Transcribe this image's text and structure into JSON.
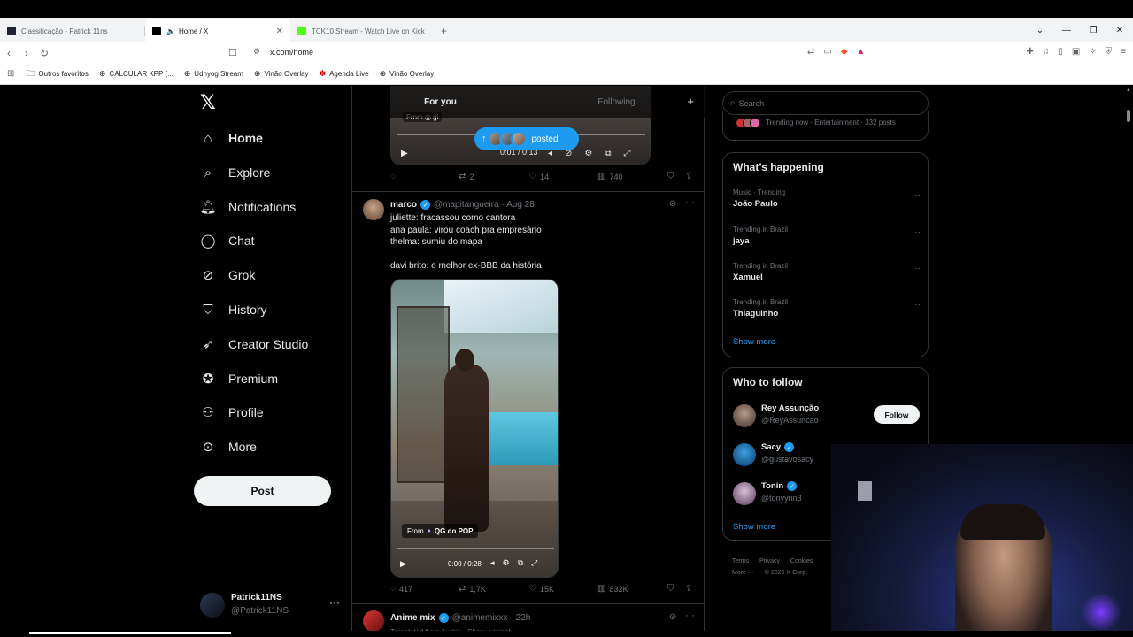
{
  "browser": {
    "tabs": [
      {
        "title": "Classificação - Patrick 11ns",
        "active": false
      },
      {
        "title": "Home / X",
        "active": true
      },
      {
        "title": "TCK10 Stream - Watch Live on Kick",
        "active": false
      }
    ],
    "new_tab": "+",
    "url": "x.com/home",
    "bookmarks": [
      {
        "label": "Outros favoritos",
        "icon": "folder-icon"
      },
      {
        "label": "CALCULAR KPP (...",
        "icon": "globe-icon"
      },
      {
        "label": "Udhyog Stream",
        "icon": "globe-icon"
      },
      {
        "label": "Vinão Overlay",
        "icon": "globe-icon"
      },
      {
        "label": "Agenda Live",
        "icon": "globe-icon"
      },
      {
        "label": "Vinão Overlay",
        "icon": "globe-icon"
      }
    ]
  },
  "nav": {
    "logo": "𝕏",
    "items": [
      {
        "label": "Home",
        "icon": "home-icon"
      },
      {
        "label": "Explore",
        "icon": "search-icon"
      },
      {
        "label": "Notifications",
        "icon": "bell-icon"
      },
      {
        "label": "Chat",
        "icon": "chat-icon"
      },
      {
        "label": "Grok",
        "icon": "grok-icon"
      },
      {
        "label": "History",
        "icon": "bookmark-icon"
      },
      {
        "label": "Creator Studio",
        "icon": "rocket-icon"
      },
      {
        "label": "Premium",
        "icon": "verified-icon"
      },
      {
        "label": "Profile",
        "icon": "person-icon"
      },
      {
        "label": "More",
        "icon": "more-circle-icon"
      }
    ],
    "post_label": "Post",
    "account": {
      "name": "Patrick11NS",
      "handle": "@Patrick11NS"
    }
  },
  "feed": {
    "tabs": [
      "For you",
      "Following"
    ],
    "posted_pill": "posted",
    "video1": {
      "time": "0:01 / 0:13"
    },
    "tweet1_actions": {
      "replies": "",
      "reposts": "2",
      "likes": "14",
      "views": "740"
    },
    "tweet2": {
      "name": "marco",
      "handle": "@mapitangueira",
      "date": "· Aug 28",
      "lines": [
        "juliette: fracassou como cantora",
        "ana paula: virou coach pra empresário",
        "thelma: sumiu do mapa",
        "",
        "davi brito: o melhor ex-BBB da história"
      ],
      "video": {
        "from_prefix": "From",
        "from_name": "QG do POP",
        "time": "0:00 / 0:28"
      },
      "actions": {
        "replies": "417",
        "reposts": "1,7K",
        "likes": "15K",
        "views": "832K"
      }
    },
    "tweet3": {
      "name": "Anime mix",
      "handle": "@animemixxx",
      "date": "· 22h",
      "sub": "Translated from Arabic · Show original"
    }
  },
  "sidebar": {
    "search_placeholder": "Search",
    "top_trend": "Trending now · Entertainment · 332 posts",
    "happening_title": "What’s happening",
    "trends": [
      {
        "context": "Music · Trending",
        "name": "João Paulo"
      },
      {
        "context": "Trending in Brazil",
        "name": "jaya"
      },
      {
        "context": "Trending in Brazil",
        "name": "Xamuel"
      },
      {
        "context": "Trending in Brazil",
        "name": "Thiaguinho"
      }
    ],
    "show_more": "Show more",
    "wtf_title": "Who to follow",
    "follow_label": "Follow",
    "wtf": [
      {
        "name": "Rey Assunção",
        "handle": "@ReyAssuncao",
        "verified": false
      },
      {
        "name": "Sacy",
        "handle": "@gustavosacy",
        "verified": true
      },
      {
        "name": "Tonin",
        "handle": "@tonyynn3",
        "verified": true
      }
    ],
    "footer_line1": [
      "Terms",
      "Privacy",
      "Cookies"
    ],
    "footer_line2": [
      "More ···",
      "© 2026 X Corp."
    ]
  },
  "colors": {
    "accent": "#1d9bf0",
    "background": "#000000",
    "text": "#e7e9ea",
    "muted": "#71767b",
    "border": "#2f3336"
  }
}
